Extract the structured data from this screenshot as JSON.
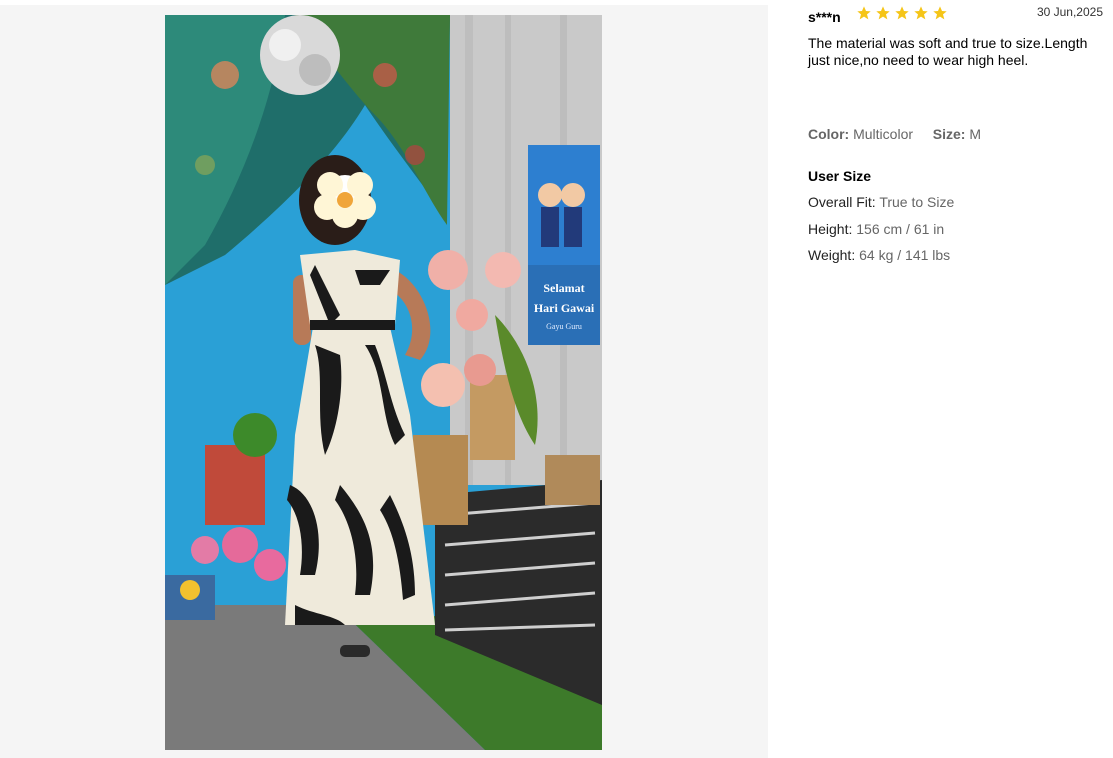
{
  "review": {
    "username": "s***n",
    "rating": 5,
    "date": "30 Jun,2025",
    "text": "The material was soft and true to size.Length just nice,no need to wear high heel.",
    "attributes": {
      "color_label": "Color:",
      "color_value": "Multicolor",
      "size_label": "Size:",
      "size_value": "M"
    },
    "user_size": {
      "title": "User Size",
      "fit_label": "Overall Fit:",
      "fit_value": "True to Size",
      "height_label": "Height:",
      "height_value": "156 cm / 61 in",
      "weight_label": "Weight:",
      "weight_value": "64 kg / 141 lbs"
    }
  },
  "photo": {
    "banner_line1": "Selamat",
    "banner_line2": "Hari Gawai",
    "banner_line3": "Gayu Guru"
  },
  "colors": {
    "star": "#f5c518",
    "wall_blue": "#2aa0d6",
    "dress_cream": "#efeadb",
    "dress_black": "#1a1a1a"
  }
}
